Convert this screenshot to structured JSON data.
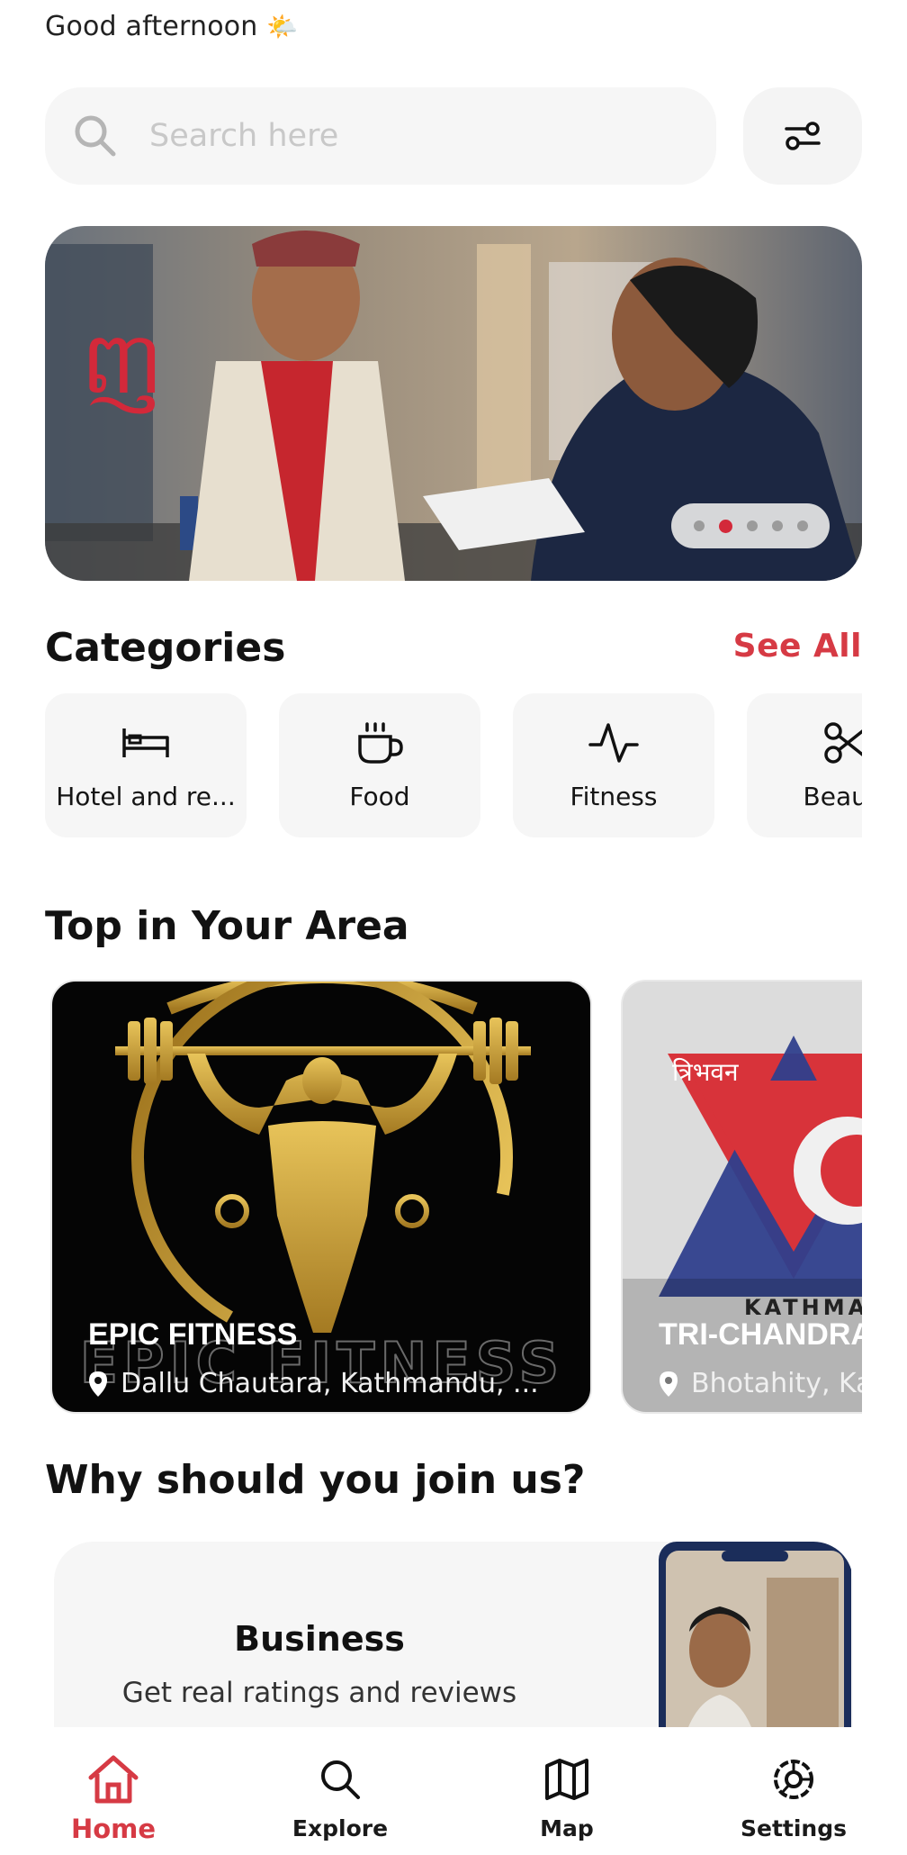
{
  "greeting": {
    "text": "Good afternoon",
    "emoji": "🌤️"
  },
  "search": {
    "placeholder": "Search here",
    "value": ""
  },
  "banner": {
    "slide_count": 5,
    "active_slide": 2
  },
  "categories": {
    "title": "Categories",
    "see_all": "See All",
    "items": [
      {
        "label": "Hotel and re...",
        "icon": "bed-icon"
      },
      {
        "label": "Food",
        "icon": "coffee-cup-icon"
      },
      {
        "label": "Fitness",
        "icon": "activity-pulse-icon"
      },
      {
        "label": "Beauty",
        "icon": "scissors-icon"
      }
    ]
  },
  "top_area": {
    "title": "Top in Your Area",
    "places": [
      {
        "name": "EPIC FITNESS",
        "location": "Dallu Chautara, Kathmandu, ..."
      },
      {
        "name": "TRI-CHANDRA",
        "location": "Bhotahity, Ka"
      }
    ]
  },
  "why_join": {
    "title": "Why should you join us?",
    "card": {
      "title": "Business",
      "description": "Get real ratings and reviews"
    }
  },
  "nav": [
    {
      "label": "Home",
      "icon": "home-icon",
      "active": true
    },
    {
      "label": "Explore",
      "icon": "search-icon",
      "active": false
    },
    {
      "label": "Map",
      "icon": "map-icon",
      "active": false
    },
    {
      "label": "Settings",
      "icon": "settings-gear-icon",
      "active": false
    }
  ],
  "colors": {
    "accent": "#d63a44",
    "surface": "#f6f6f6"
  }
}
